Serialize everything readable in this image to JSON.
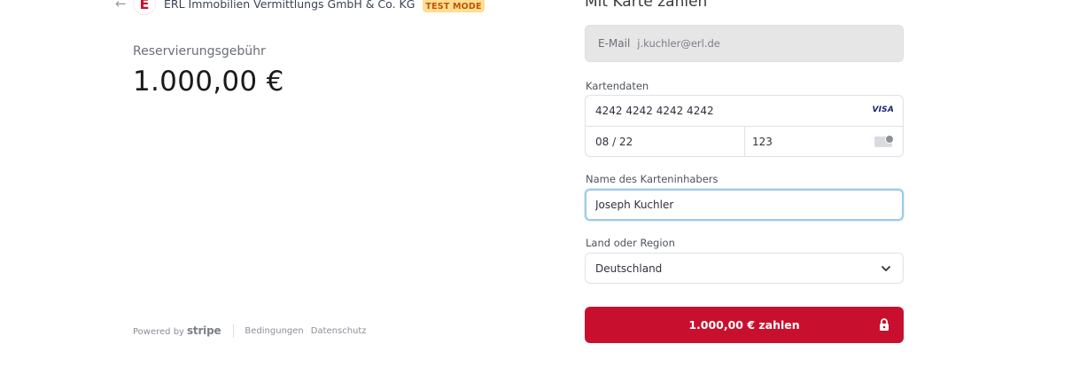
{
  "merchant": {
    "back_icon": "arrow-left-icon",
    "logo_text": "E",
    "name": "ERL Immobilien Vermittlungs GmbH & Co. KG",
    "test_badge": "TEST MODE",
    "badge_color": "#ffde92"
  },
  "summary": {
    "label": "Reservierungsgebühr",
    "amount": "1.000,00 €"
  },
  "footer": {
    "powered_by": "Powered by",
    "stripe": "stripe",
    "terms": "Bedingungen",
    "privacy": "Datenschutz"
  },
  "form": {
    "title": "Mit Karte zahlen",
    "email_label": "E-Mail",
    "email_value": "j.kuchler@erl.de",
    "card_label": "Kartendaten",
    "card_number": "4242 4242 4242 4242",
    "card_brand": "VISA",
    "expiry": "08 / 22",
    "cvc": "123",
    "name_label": "Name des Karteninhabers",
    "name_value": "Joseph Kuchler",
    "country_label": "Land oder Region",
    "country_value": "Deutschland",
    "pay_label": "1.000,00 € zahlen",
    "accent_color": "#c8102e"
  }
}
